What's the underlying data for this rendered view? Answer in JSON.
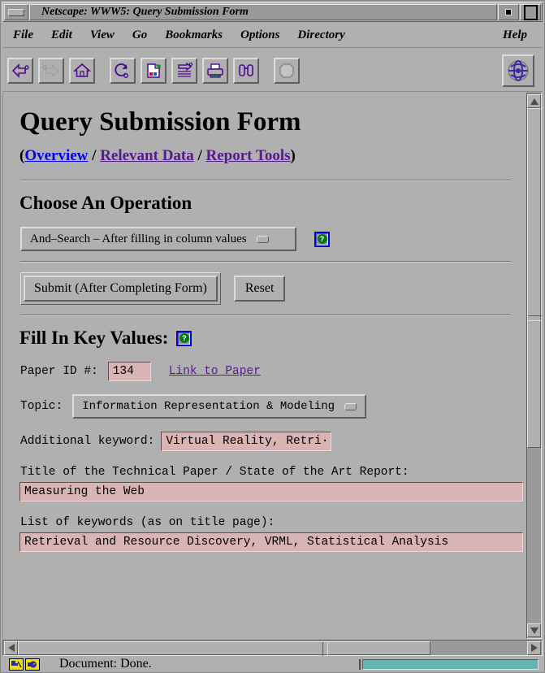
{
  "window": {
    "title": "Netscape: WWW5: Query Submission Form",
    "menu_button_icon": "window-menu-icon",
    "minimize_icon": "minimize-icon",
    "maximize_icon": "maximize-icon"
  },
  "menubar": {
    "items": [
      {
        "label": "File"
      },
      {
        "label": "Edit"
      },
      {
        "label": "View"
      },
      {
        "label": "Go"
      },
      {
        "label": "Bookmarks"
      },
      {
        "label": "Options"
      },
      {
        "label": "Directory"
      }
    ],
    "help": "Help"
  },
  "toolbar": {
    "buttons": [
      {
        "name": "back-icon"
      },
      {
        "name": "forward-icon"
      },
      {
        "name": "home-icon"
      },
      {
        "name": "reload-icon"
      },
      {
        "name": "images-icon"
      },
      {
        "name": "open-icon"
      },
      {
        "name": "print-icon"
      },
      {
        "name": "find-icon"
      },
      {
        "name": "stop-icon"
      }
    ],
    "logo": "netscape-logo-icon"
  },
  "page": {
    "heading": "Query Submission Form",
    "nav": {
      "open_paren": "(",
      "close_paren": ")",
      "sep": "/",
      "links": [
        {
          "label": "Overview",
          "state": "unvisited",
          "color": "#0000ee"
        },
        {
          "label": "Relevant Data",
          "state": "visited",
          "color": "#551a8b"
        },
        {
          "label": "Report Tools",
          "state": "visited",
          "color": "#551a8b"
        }
      ]
    },
    "operation": {
      "heading": "Choose An Operation",
      "selected": "And–Search – After filling in column values",
      "help_icon": "help-question-icon"
    },
    "actions": {
      "submit": "Submit (After Completing Form)",
      "reset": "Reset"
    },
    "keyvalues": {
      "heading": "Fill In Key Values:",
      "help_icon": "help-question-icon",
      "paper_id": {
        "label": "Paper ID #:",
        "value": "134",
        "link": "Link to Paper"
      },
      "topic": {
        "label": "Topic:",
        "selected": "Information Representation & Modeling"
      },
      "keyword": {
        "label": "Additional keyword:",
        "value": "Virtual Reality, Retri·"
      },
      "title_field": {
        "label": "Title of the Technical Paper / State of the Art Report:",
        "value": "Measuring the Web"
      },
      "keywords_field": {
        "label": "List of keywords (as on title page):",
        "value": "Retrieval and Resource Discovery, VRML, Statistical Analysis"
      }
    }
  },
  "scrollbars": {
    "vertical": {
      "up_icon": "scroll-up-arrow-icon",
      "down_icon": "scroll-down-arrow-icon"
    },
    "horizontal": {
      "left_icon": "scroll-left-arrow-icon",
      "right_icon": "scroll-right-arrow-icon"
    }
  },
  "statusbar": {
    "text": "Document: Done.",
    "security_icon": "broken-key-icon",
    "mail_icon": "mail-status-icon",
    "progress_color": "#64b4b4"
  }
}
